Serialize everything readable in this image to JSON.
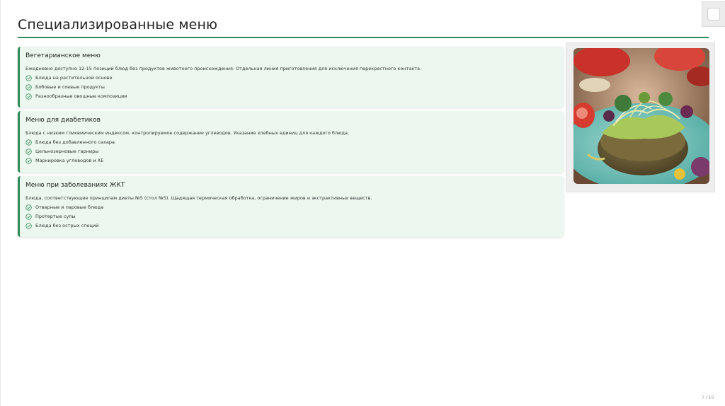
{
  "slide": {
    "title": "Специализированные меню",
    "page_number": "7 / 10"
  },
  "cards": [
    {
      "title": "Вегетарианское меню",
      "description": "Ежедневно доступно 12-15 позиций блюд без продуктов животного происхождения. Отдельная линия приготовления для исключения перекрестного контакта.",
      "items": [
        "Блюда на растительной основе",
        "Бобовые и соевые продукты",
        "Разнообразные овощные композиции"
      ]
    },
    {
      "title": "Меню для диабетиков",
      "description": "Блюда с низким гликемическим индексом, контролируемое содержание углеводов. Указание хлебных единиц для каждого блюда.",
      "items": [
        "Блюда без добавленного сахара",
        "Цельнозерновые гарниры",
        "Маркировка углеводов и ХЕ"
      ]
    },
    {
      "title": "Меню при заболеваниях ЖКТ",
      "description": "Блюда, соответствующие принципам диеты №5 (стол №5). Щадящая термическая обработка, ограничение жиров и экстрактивных веществ.",
      "items": [
        "Отварные и паровые блюда",
        "Протертые супы",
        "Блюда без острых специй"
      ]
    }
  ],
  "colors": {
    "accent": "#2e8b57",
    "card_background": "#ebf7ef"
  },
  "icons": {
    "list_marker": "check-circle-icon"
  }
}
